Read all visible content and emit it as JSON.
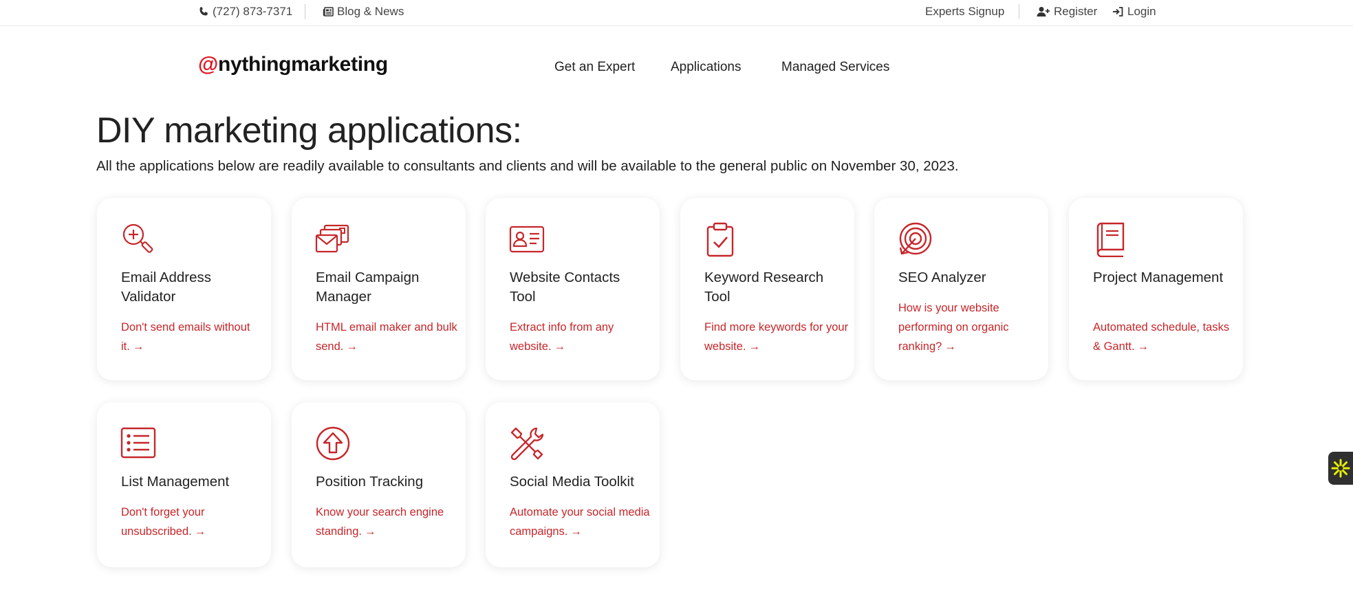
{
  "topbar": {
    "phone": "(727) 873-7371",
    "blog": "Blog & News",
    "experts_signup": "Experts Signup",
    "register": "Register",
    "login": "Login"
  },
  "header": {
    "logo_at": "@",
    "logo_text": "nythingmarketing",
    "nav": [
      "Get an Expert",
      "Applications",
      "Managed Services"
    ]
  },
  "main": {
    "title": "DIY marketing applications:",
    "subtitle": "All the applications below are readily available to consultants and clients and will be available to the general public on November 30, 2023."
  },
  "cards": [
    {
      "title": "Email Address Validator",
      "desc": "Don't send emails without it.",
      "icon": "magnifier-plus-icon"
    },
    {
      "title": "Email Campaign Manager",
      "desc": "HTML email maker and bulk send.",
      "icon": "email-stack-icon"
    },
    {
      "title": "Website Contacts Tool",
      "desc": "Extract info from any website.",
      "icon": "contact-card-icon"
    },
    {
      "title": "Keyword Research Tool",
      "desc": "Find more keywords for your website.",
      "icon": "clipboard-check-icon"
    },
    {
      "title": "SEO Analyzer",
      "desc": "How is your website performing on organic ranking?",
      "icon": "target-arrow-icon"
    },
    {
      "title": "Project Management",
      "desc": "Automated schedule, tasks & Gantt.",
      "icon": "book-icon"
    },
    {
      "title": "List Management",
      "desc": "Don't forget your unsubscribed.",
      "icon": "list-icon"
    },
    {
      "title": "Position Tracking",
      "desc": "Know your search engine standing.",
      "icon": "arrow-up-circle-icon"
    },
    {
      "title": "Social Media Toolkit",
      "desc": "Automate your social media campaigns.",
      "icon": "tools-icon"
    }
  ],
  "arrow_glyph": "→",
  "colors": {
    "accent": "#c6262a",
    "logo_red": "#e0141e",
    "text": "#222222",
    "widget_bg": "#303030",
    "widget_star": "#e8f000"
  }
}
